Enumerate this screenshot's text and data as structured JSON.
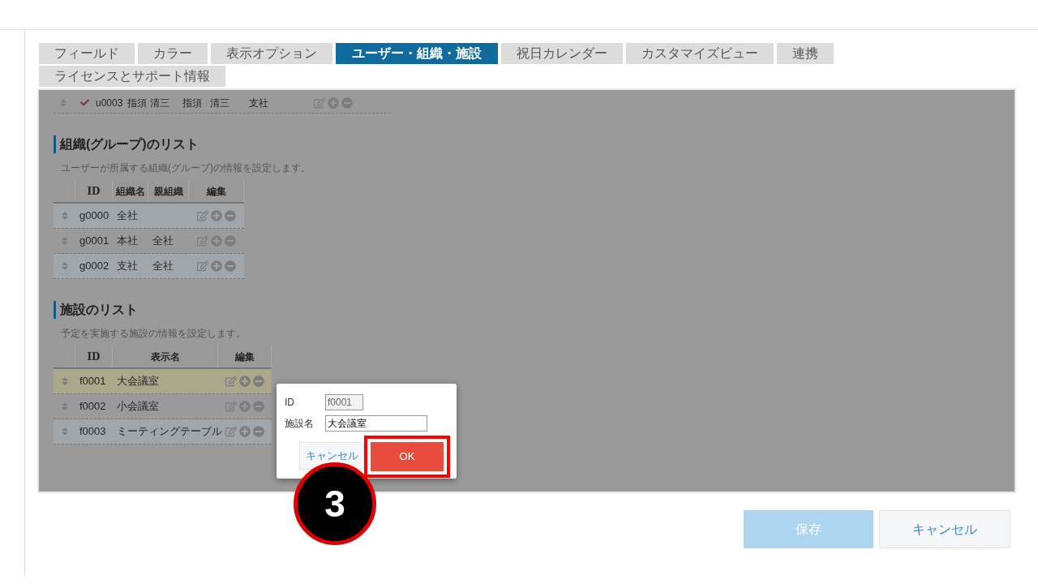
{
  "tab_rows": [
    [
      {
        "label": "フィールド",
        "selected": false
      },
      {
        "label": "カラー",
        "selected": false
      },
      {
        "label": "表示オプション",
        "selected": false
      },
      {
        "label": "ユーザー・組織・施設",
        "selected": true
      },
      {
        "label": "祝日カレンダー",
        "selected": false
      },
      {
        "label": "カスタマイズビュー",
        "selected": false
      },
      {
        "label": "連携",
        "selected": false
      }
    ],
    [
      {
        "label": "ライセンスとサポート情報",
        "selected": false
      }
    ]
  ],
  "user_row": {
    "checked": true,
    "cells": [
      "u0003",
      "指須 清三",
      "指須",
      "清三",
      "支社"
    ]
  },
  "groups": {
    "title": "組織(グループ)のリスト",
    "description": "ユーザーが所属する組織(グループ)の情報を設定します。",
    "columns": [
      "ID",
      "組織名",
      "親組織",
      "編集"
    ],
    "rows": [
      {
        "cells": [
          "g0000",
          "全社",
          ""
        ],
        "selected": false
      },
      {
        "cells": [
          "g0001",
          "本社",
          "全社"
        ],
        "selected": false
      },
      {
        "cells": [
          "g0002",
          "支社",
          "全社"
        ],
        "selected": false
      }
    ]
  },
  "facilities": {
    "title": "施設のリスト",
    "description": "予定を実施する施設の情報を設定します。",
    "columns": [
      "ID",
      "表示名",
      "編集"
    ],
    "rows": [
      {
        "cells": [
          "f0001",
          "大会議室"
        ],
        "selected": true
      },
      {
        "cells": [
          "f0002",
          "小会議室"
        ],
        "selected": false
      },
      {
        "cells": [
          "f0003",
          "ミーティングテーブル"
        ],
        "selected": false
      }
    ]
  },
  "dialog": {
    "fields": [
      {
        "label": "ID",
        "value": "f0001",
        "disabled": true
      },
      {
        "label": "施設名",
        "value": "大会議室",
        "disabled": false
      }
    ],
    "cancel": "キャンセル",
    "ok": "OK"
  },
  "step_badge": "3",
  "footer": {
    "save": {
      "label": "保存",
      "disabled": true
    },
    "cancel": "キャンセル"
  }
}
